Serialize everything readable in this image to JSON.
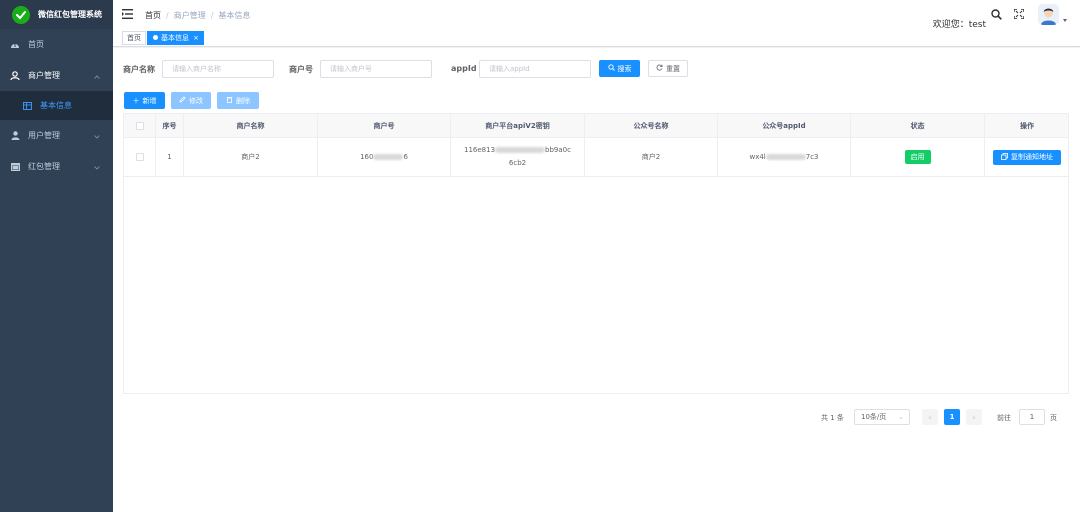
{
  "app": {
    "title": "微信红包管理系统"
  },
  "sidebar": {
    "items": [
      {
        "label": "首页"
      },
      {
        "label": "商户管理"
      },
      {
        "label": "基本信息"
      },
      {
        "label": "用户管理"
      },
      {
        "label": "红包管理"
      }
    ]
  },
  "breadcrumb": [
    "首页",
    "商户管理",
    "基本信息"
  ],
  "user": {
    "welcome": "欢迎您：test"
  },
  "tags": [
    {
      "label": "首页"
    },
    {
      "label": "基本信息",
      "close": "×"
    }
  ],
  "search": {
    "fields": [
      {
        "label": "商户名称",
        "placeholder": "请输入商户名称"
      },
      {
        "label": "商户号",
        "placeholder": "请输入商户号"
      },
      {
        "label": "appId",
        "placeholder": "请输入appId"
      }
    ],
    "search_button": "搜索",
    "reset_button": "重置"
  },
  "actions": {
    "add": "新增",
    "edit": "修改",
    "delete": "删除"
  },
  "table": {
    "headers": [
      "序号",
      "商户名称",
      "商户号",
      "商户平台apiV2密钥",
      "公众号名称",
      "公众号appId",
      "状态",
      "操作"
    ],
    "rows": [
      {
        "index": "1",
        "merchant_name": "商户2",
        "merchant_no_start": "160",
        "merchant_no_end": "6",
        "api_key_line1_start": "116e813",
        "api_key_line1_end": "bb9a0c",
        "api_key_line2": "6cb2",
        "mp_name": "商户2",
        "appid_start": "wx4l",
        "appid_end": "7c3",
        "status": "启用",
        "operation": "复制通知地址"
      }
    ]
  },
  "pagination": {
    "total": "共 1 条",
    "page_size": "10条/页",
    "current_page": "1",
    "goto_label": "前往",
    "goto_value": "1",
    "page_suffix": "页"
  },
  "colors": {
    "primary": "#1890ff",
    "success": "#13ce66",
    "sidebar": "#304156"
  }
}
